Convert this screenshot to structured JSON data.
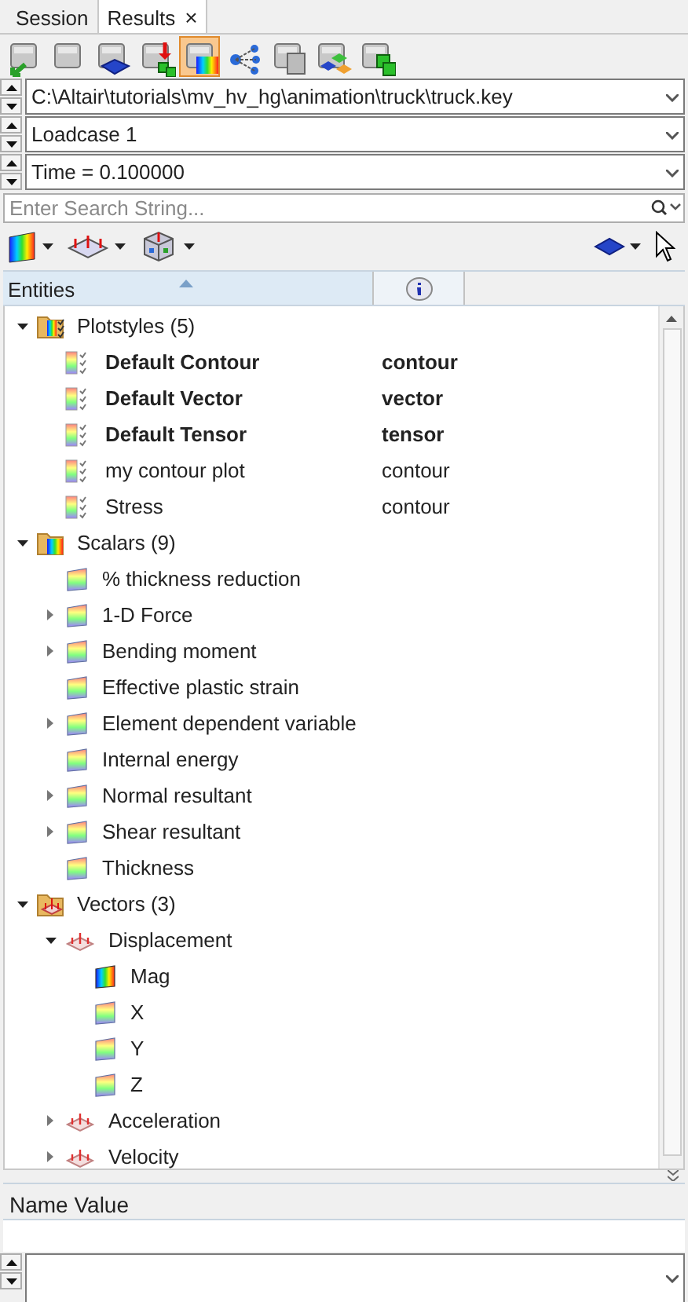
{
  "tabs": [
    {
      "label": "Session",
      "selected": false
    },
    {
      "label": "Results",
      "selected": true,
      "close": "×"
    }
  ],
  "toolbar": [
    {
      "selected": false
    },
    {
      "selected": false
    },
    {
      "selected": false
    },
    {
      "selected": false
    },
    {
      "selected": true
    },
    {
      "selected": false
    },
    {
      "selected": false
    },
    {
      "selected": false
    },
    {
      "selected": false
    }
  ],
  "selectors": [
    {
      "value": "C:\\Altair\\tutorials\\mv_hv_hg\\animation\\truck\\truck.key"
    },
    {
      "value": "Loadcase 1"
    },
    {
      "value": "Time = 0.100000"
    }
  ],
  "search": {
    "placeholder": "Enter Search String..."
  },
  "tree": {
    "columns": [
      "Entities"
    ],
    "items": [
      {
        "label": "Plotstyles (5)",
        "kind": "plotstyles",
        "expanded": true,
        "children": [
          {
            "label": "Default Contour",
            "type": "contour",
            "kind": "plotstyle",
            "bold": true
          },
          {
            "label": "Default Vector",
            "type": "vector",
            "kind": "plotstyle",
            "bold": true
          },
          {
            "label": "Default Tensor",
            "type": "tensor",
            "kind": "plotstyle",
            "bold": true
          },
          {
            "label": "my contour plot",
            "type": "contour",
            "kind": "plotstyle",
            "bold": false
          },
          {
            "label": "Stress",
            "type": "contour",
            "kind": "plotstyle",
            "bold": false
          }
        ]
      },
      {
        "label": "Scalars (9)",
        "kind": "scalars",
        "expanded": true,
        "children": [
          {
            "label": "% thickness reduction",
            "kind": "scalar"
          },
          {
            "label": "1-D Force",
            "kind": "scalar",
            "expanded": false
          },
          {
            "label": "Bending moment",
            "kind": "scalar",
            "expanded": false
          },
          {
            "label": "Effective plastic strain",
            "kind": "scalar"
          },
          {
            "label": "Element dependent variable",
            "kind": "scalar",
            "expanded": false
          },
          {
            "label": "Internal energy",
            "kind": "scalar"
          },
          {
            "label": "Normal resultant",
            "kind": "scalar",
            "expanded": false
          },
          {
            "label": "Shear resultant",
            "kind": "scalar",
            "expanded": false
          },
          {
            "label": "Thickness",
            "kind": "scalar"
          }
        ]
      },
      {
        "label": "Vectors (3)",
        "kind": "vectors",
        "expanded": true,
        "children": [
          {
            "label": "Displacement",
            "kind": "vector",
            "expanded": true,
            "children": [
              {
                "label": "Mag",
                "kind": "magnitude"
              },
              {
                "label": "X",
                "kind": "component"
              },
              {
                "label": "Y",
                "kind": "component"
              },
              {
                "label": "Z",
                "kind": "component"
              }
            ]
          },
          {
            "label": "Acceleration",
            "kind": "vector",
            "expanded": false
          },
          {
            "label": "Velocity",
            "kind": "vector",
            "expanded": false
          }
        ]
      }
    ]
  },
  "properties": {
    "header": "Name Value"
  }
}
